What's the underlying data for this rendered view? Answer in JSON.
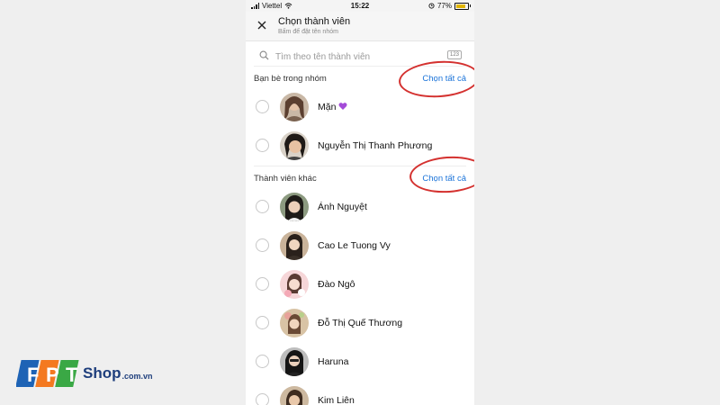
{
  "status_bar": {
    "carrier": "Viettel",
    "time": "15:22",
    "battery": "77%"
  },
  "header": {
    "title": "Chọn thành viên",
    "subtitle": "Bấm để đặt tên nhóm"
  },
  "search": {
    "placeholder": "Tìm theo tên thành viên",
    "keyboard_badge": "123"
  },
  "sections": [
    {
      "label": "Bạn bè trong nhóm",
      "select_all": "Chọn tất cả",
      "members": [
        {
          "name": "Mặn",
          "avatar_color": "#7b5a48",
          "has_heart": true
        },
        {
          "name": "Nguyễn Thị Thanh Phương",
          "avatar_color": "#4a4440"
        }
      ]
    },
    {
      "label": "Thành viên khác",
      "select_all": "Chọn tất cả",
      "members": [
        {
          "name": "Ánh Nguyệt",
          "avatar_color": "#3a3d33"
        },
        {
          "name": "Cao Le Tuong Vy",
          "avatar_color": "#5a4a3a"
        },
        {
          "name": "Đào Ngô",
          "avatar_color": "#f0c8c8"
        },
        {
          "name": "Đỗ Thị Quế Thương",
          "avatar_color": "#a0826a"
        },
        {
          "name": "Haruna",
          "avatar_color": "#2e2e2e"
        },
        {
          "name": "Kim Liên",
          "avatar_color": "#6b5a4a"
        }
      ]
    }
  ],
  "brand": {
    "logo_letters": [
      "F",
      "P",
      "T"
    ],
    "shop": "Shop",
    "domain": ".com.vn"
  },
  "colors": {
    "accent_link": "#1a73d9",
    "annotation_circle": "#d4312f",
    "brand_blue": "#1e3e7c",
    "brand_orange": "#f47920"
  }
}
